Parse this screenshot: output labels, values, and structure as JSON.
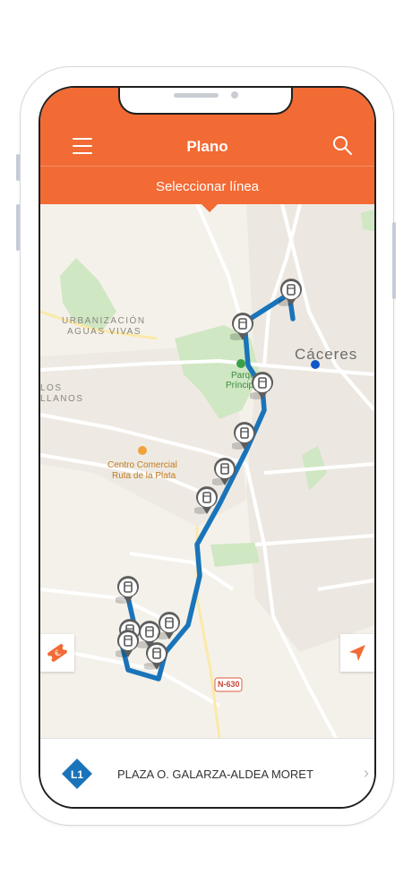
{
  "header": {
    "title": "Plano",
    "line_selector": "Seleccionar línea",
    "background": "#f26a34"
  },
  "map": {
    "labels": {
      "urbanizacion": "URBANIZACIÓN",
      "aguas_vivas": "AGUAS VIVAS",
      "caceres": "Cáceres",
      "parque": "Parque",
      "principe": "Príncipe",
      "los": "LOS",
      "llanos": "LLANOS",
      "centro_comercial": "Centro Comercial",
      "ruta_plata": "Ruta de la Plata",
      "road_n630": "N-630"
    },
    "route_color": "#1a74ba",
    "stop_icon": "bus-stop-pin-icon",
    "user_location_color": "#0f57c9"
  },
  "buttons": {
    "ticket_icon": "ticket-euro-icon",
    "locate_icon": "navigation-arrow-icon"
  },
  "bottom_bar": {
    "line_badge": "L1",
    "badge_color": "#1a74ba",
    "stop_name": "PLAZA O. GALARZA-ALDEA MORET",
    "chevron": "›"
  }
}
